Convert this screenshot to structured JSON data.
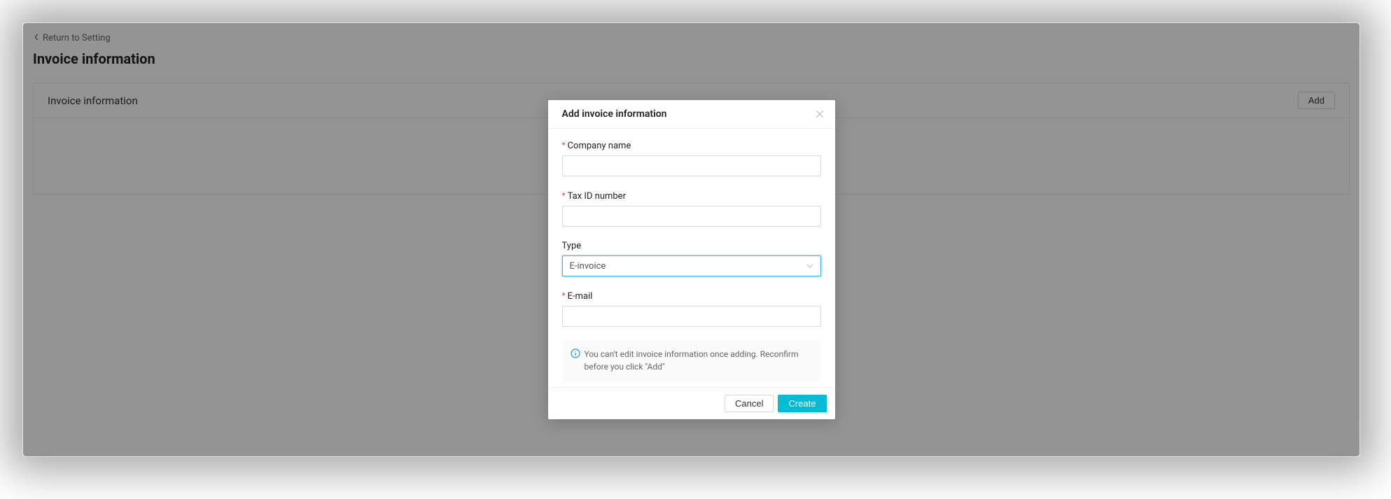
{
  "back_link": "Return to Setting",
  "page_title": "Invoice information",
  "panel": {
    "header": "Invoice information",
    "add_button": "Add"
  },
  "modal": {
    "title": "Add invoice information",
    "fields": {
      "company_name": {
        "label": "Company name",
        "required": true,
        "value": ""
      },
      "tax_id": {
        "label": "Tax ID number",
        "required": true,
        "value": ""
      },
      "type": {
        "label": "Type",
        "required": false,
        "value": "E-invoice"
      },
      "email": {
        "label": "E-mail",
        "required": true,
        "value": ""
      }
    },
    "notice": "You can't edit invoice information once adding. Reconfirm before you click \"Add\"",
    "buttons": {
      "cancel": "Cancel",
      "create": "Create"
    }
  }
}
